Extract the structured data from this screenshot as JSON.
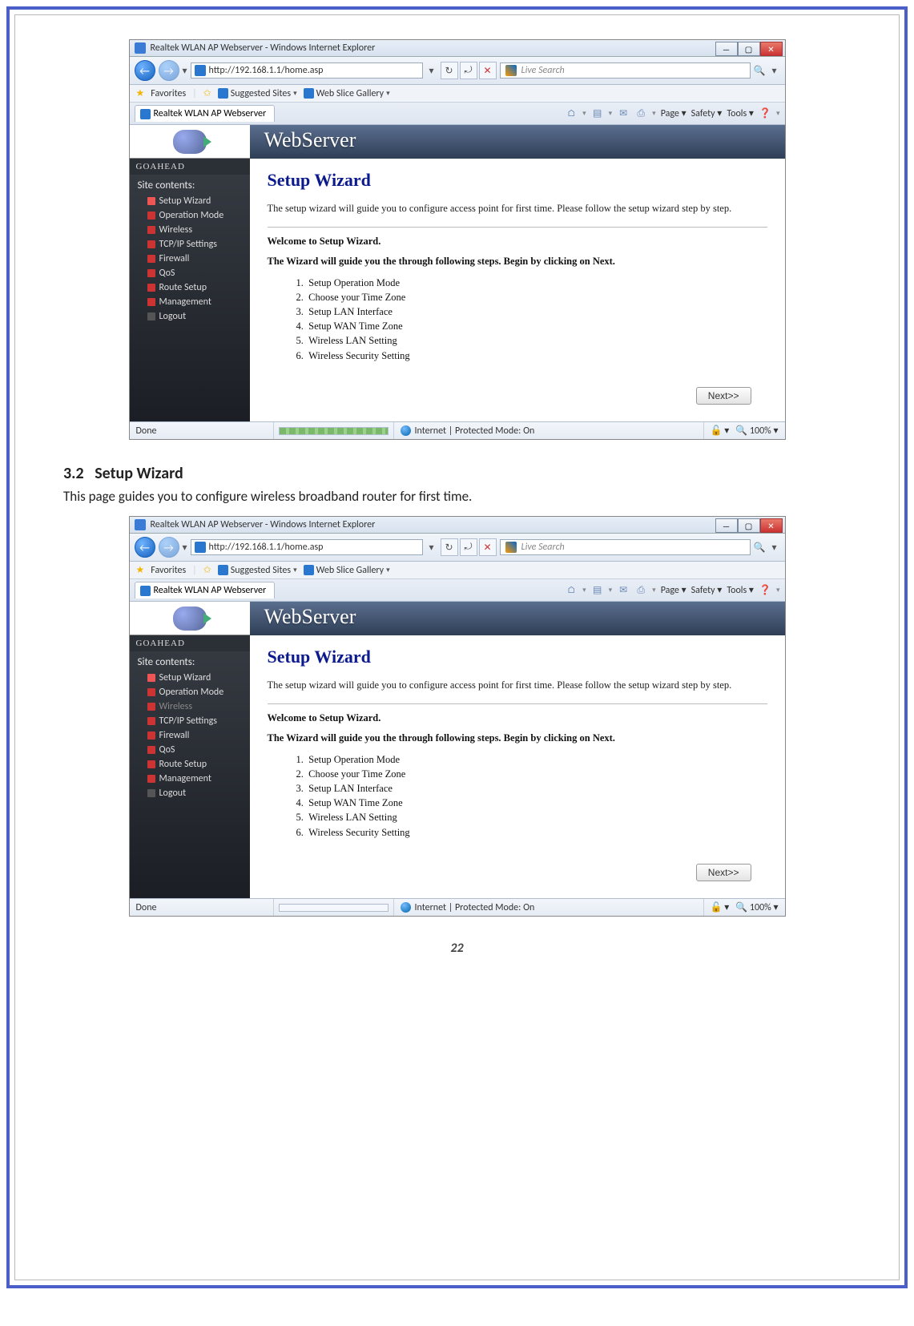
{
  "doc": {
    "section_number": "3.2",
    "section_title": "Setup Wizard",
    "section_text": "This page guides you to configure wireless broadband router for first time.",
    "page_number": "22"
  },
  "ie": {
    "window_title": "Realtek WLAN AP Webserver - Windows Internet Explorer",
    "url": "http://192.168.1.1/home.asp",
    "search_placeholder": "Live Search",
    "favorites_label": "Favorites",
    "suggested_sites": "Suggested Sites",
    "web_slice": "Web Slice Gallery",
    "tab_label": "Realtek WLAN AP Webserver",
    "cmd": {
      "page": "Page",
      "safety": "Safety",
      "tools": "Tools"
    },
    "status_done": "Done",
    "status_zone": "Internet | Protected Mode: On",
    "status_zoom": "100%"
  },
  "router": {
    "banner": "WebServer",
    "brand": "GOAHEAD",
    "tree_title": "Site contents:",
    "menu": [
      "Setup Wizard",
      "Operation Mode",
      "Wireless",
      "TCP/IP Settings",
      "Firewall",
      "QoS",
      "Route Setup",
      "Management",
      "Logout"
    ],
    "h1": "Setup Wizard",
    "desc": "The setup wizard will guide you to configure access point for first time. Please follow the setup wizard step by step.",
    "welcome": "Welcome to Setup Wizard.",
    "lead": "The Wizard will guide you the through following steps. Begin by clicking on Next.",
    "steps": [
      "Setup Operation Mode",
      "Choose your Time Zone",
      "Setup LAN Interface",
      "Setup WAN Time Zone",
      "Wireless LAN Setting",
      "Wireless Security Setting"
    ],
    "next_label": "Next>>"
  }
}
